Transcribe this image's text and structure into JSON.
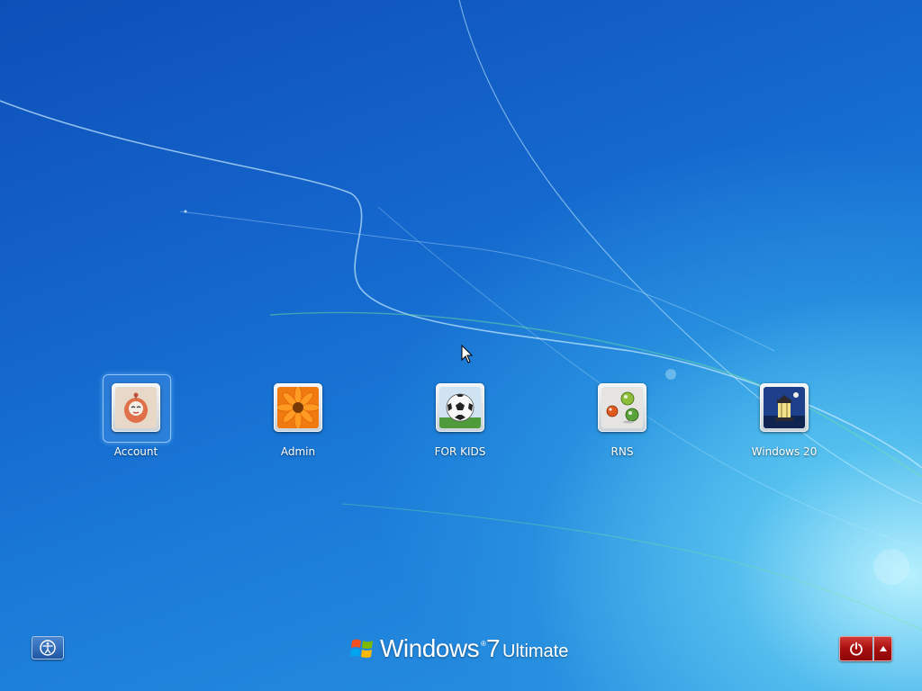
{
  "users": [
    {
      "name": "Account",
      "picture": "cartoon-character-picture",
      "selected": true
    },
    {
      "name": "Admin",
      "picture": "orange-flower-picture",
      "selected": false
    },
    {
      "name": "FOR KIDS",
      "picture": "soccer-ball-picture",
      "selected": false
    },
    {
      "name": "RNS",
      "picture": "marbles-picture",
      "selected": false
    },
    {
      "name": "Windows 20",
      "picture": "lighthouse-picture",
      "selected": false
    }
  ],
  "brand": {
    "word": "Windows",
    "trademark": "®",
    "version": "7",
    "edition": "Ultimate"
  },
  "controls": {
    "ease_of_access_icon": "ease-of-access-icon",
    "power_icon": "power-icon",
    "power_options_icon": "up-arrow-icon"
  },
  "colors": {
    "background_dark": "#0d4fb8",
    "background_light": "#bff5ff",
    "power_red": "#a8100f"
  }
}
